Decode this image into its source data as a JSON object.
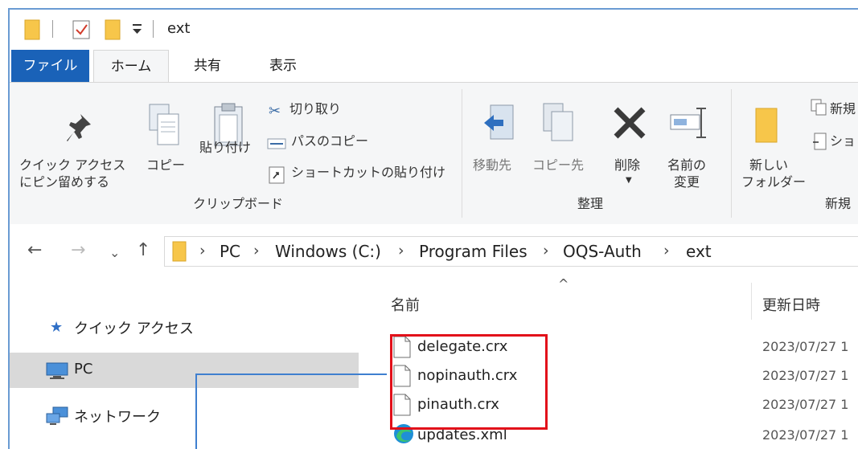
{
  "window": {
    "title": "ext"
  },
  "ribbon_tabs": {
    "file": "ファイル",
    "home": "ホーム",
    "share": "共有",
    "view": "表示"
  },
  "ribbon": {
    "pin_label_1": "クイック アクセス",
    "pin_label_2": "にピン留めする",
    "copy": "コピー",
    "paste": "貼り付け",
    "cut": "切り取り",
    "copy_path": "パスのコピー",
    "paste_shortcut": "ショートカットの貼り付け",
    "clipboard_group": "クリップボード",
    "move_to": "移動先",
    "copy_to": "コピー先",
    "delete": "削除",
    "rename_1": "名前の",
    "rename_2": "変更",
    "organize_group": "整理",
    "new_folder_1": "新しい",
    "new_folder_2": "フォルダー",
    "new_item": "新規",
    "easy_access": "ショ",
    "new_group": "新規"
  },
  "address": {
    "crumbs": [
      "PC",
      "Windows (C:)",
      "Program Files",
      "OQS-Auth",
      "ext"
    ]
  },
  "nav_pane": {
    "items": [
      {
        "label": "クイック アクセス",
        "icon": "star-icon"
      },
      {
        "label": "PC",
        "icon": "computer-icon"
      },
      {
        "label": "ネットワーク",
        "icon": "network-icon"
      }
    ]
  },
  "file_list": {
    "columns": {
      "name": "名前",
      "modified": "更新日時"
    },
    "files": [
      {
        "name": "delegate.crx",
        "modified": "2023/07/27 1",
        "icon": "file-icon"
      },
      {
        "name": "nopinauth.crx",
        "modified": "2023/07/27 1",
        "icon": "file-icon"
      },
      {
        "name": "pinauth.crx",
        "modified": "2023/07/27 1",
        "icon": "file-icon"
      },
      {
        "name": "updates.xml",
        "modified": "2023/07/27 1",
        "icon": "edge-icon"
      }
    ]
  },
  "colors": {
    "accent": "#1a62b8",
    "highlight": "#e2101a",
    "connector": "#3f7fcf",
    "selection": "#d9d9d9"
  }
}
